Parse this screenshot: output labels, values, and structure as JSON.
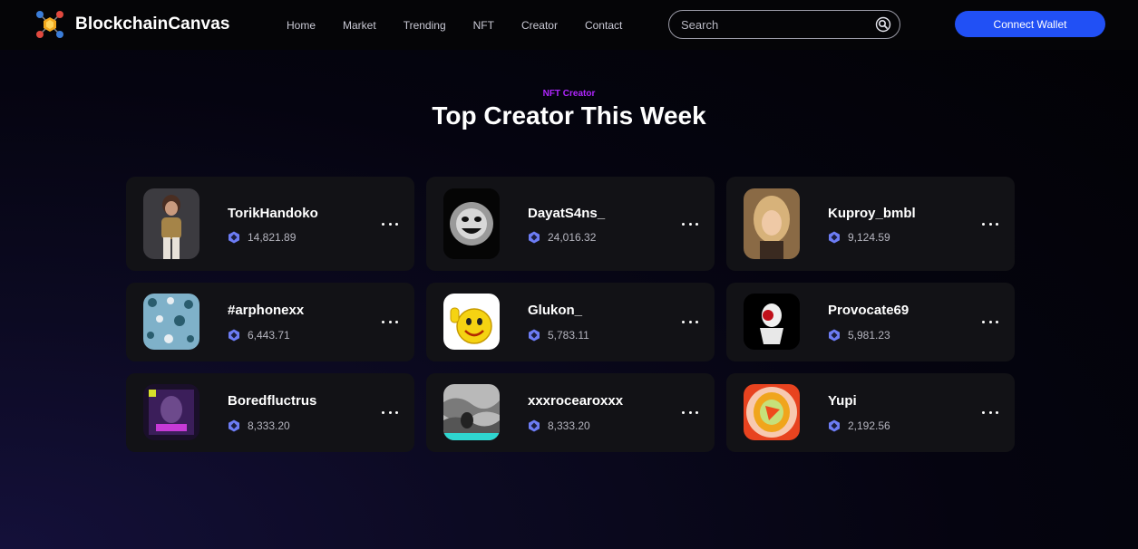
{
  "brand": {
    "name": "BlockchainCanvas",
    "logo": "hexagon-network-logo"
  },
  "nav": {
    "links": [
      "Home",
      "Market",
      "Trending",
      "NFT",
      "Creator",
      "Contact"
    ]
  },
  "search": {
    "placeholder": "Search",
    "icon": "search-icon"
  },
  "connect_wallet": {
    "label": "Connect Wallet",
    "color": "#2150f5"
  },
  "section": {
    "eyebrow": "NFT Creator",
    "eyebrow_color": "#b026ff",
    "title": "Top Creator This Week"
  },
  "creators": [
    {
      "name": "TorikHandoko",
      "value": "14,821.89",
      "avatar": "3d-character"
    },
    {
      "name": "DayatS4ns_",
      "value": "24,016.32",
      "avatar": "scary-face"
    },
    {
      "name": "Kuproy_bmbl",
      "value": "9,124.59",
      "avatar": "portrait"
    },
    {
      "name": "#arphonexx",
      "value": "6,443.71",
      "avatar": "pattern"
    },
    {
      "name": "Glukon_",
      "value": "5,783.11",
      "avatar": "thumbs-up-emoji"
    },
    {
      "name": "Provocate69",
      "value": "5,981.23",
      "avatar": "statue-bust"
    },
    {
      "name": "Boredfluctrus",
      "value": "8,333.20",
      "avatar": "neon-art"
    },
    {
      "name": "xxxrocearoxxx",
      "value": "8,333.20",
      "avatar": "monochrome-wave"
    },
    {
      "name": "Yupi",
      "value": "2,192.56",
      "avatar": "concentric-shapes"
    }
  ],
  "currency_icon": "eth-hexagon-icon",
  "more_icon": "more-dots-icon"
}
